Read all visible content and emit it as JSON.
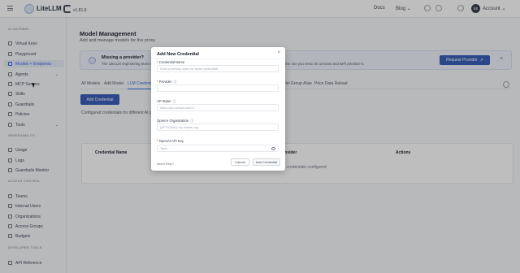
{
  "header": {
    "brand": "LiteLLM",
    "version": "v1.81.9",
    "docs": "Docs",
    "blog": "Blog",
    "avatar": "SE",
    "account": "Account",
    "icons": [
      "theme-icon",
      "github-icon",
      "bell-icon"
    ]
  },
  "sidebar": {
    "sections": [
      {
        "title": "AI GATEWAY",
        "items": [
          {
            "label": "Virtual Keys",
            "icon": "key-icon"
          },
          {
            "label": "Playground",
            "icon": "play-icon"
          },
          {
            "label": "Models + Endpoints",
            "icon": "models-icon",
            "active": true
          },
          {
            "label": "Agents",
            "icon": "agents-icon",
            "chevron": true
          },
          {
            "label": "MCP Servers",
            "icon": "mcp-icon"
          },
          {
            "label": "Skills",
            "icon": "skills-icon"
          },
          {
            "label": "Guardrails",
            "icon": "shield-icon"
          },
          {
            "label": "Policies",
            "icon": "policy-icon"
          },
          {
            "label": "Tools",
            "icon": "tools-icon",
            "chevron": true
          }
        ]
      },
      {
        "title": "OBSERVABILITY",
        "items": [
          {
            "label": "Usage",
            "icon": "usage-icon"
          },
          {
            "label": "Logs",
            "icon": "logs-icon"
          },
          {
            "label": "Guardrails Monitor",
            "icon": "monitor-icon"
          }
        ]
      },
      {
        "title": "ACCESS CONTROL",
        "items": [
          {
            "label": "Teams",
            "icon": "teams-icon"
          },
          {
            "label": "Internal Users",
            "icon": "user-icon"
          },
          {
            "label": "Organizations",
            "icon": "org-icon"
          },
          {
            "label": "Access Groups",
            "icon": "group-icon"
          },
          {
            "label": "Budgets",
            "icon": "budget-icon"
          }
        ]
      },
      {
        "title": "DEVELOPER TOOLS",
        "items": [
          {
            "label": "API Reference",
            "icon": "api-icon"
          }
        ]
      }
    ]
  },
  "page": {
    "title": "Model Management",
    "subtitle": "Add and manage models for the proxy"
  },
  "banner": {
    "title": "Missing a provider?",
    "text": "The LiteLLM engineering team is constantly adding support for new LLM models, providers, endpoints. If you don't see the one you need, let us know and we'll prioritize it.",
    "button": "Request Provider",
    "close": "×"
  },
  "tabs": [
    {
      "label": "All Models"
    },
    {
      "label": "Add Model"
    },
    {
      "label": "LLM Credentials",
      "active": true
    },
    {
      "label": "Pass-Through Endpoints"
    },
    {
      "label": "Health Status"
    },
    {
      "label": "Model Retry Settings"
    },
    {
      "label": "Model Group Alias"
    },
    {
      "label": "Price Data Reload"
    }
  ],
  "credentials": {
    "add_button": "Add Credential",
    "description": "Configured credentials for different AI providers. Add and manage your API credentials.",
    "columns": [
      "Credential Name",
      "Provider",
      "Actions"
    ],
    "empty": "No credentials configured"
  },
  "modal": {
    "title": "Add New Credential",
    "close": "×",
    "fields": [
      {
        "label": "Credential Name",
        "required": true,
        "placeholder": "Enter a friendly name for these credentials"
      },
      {
        "label": "Provider",
        "required": true,
        "info": "ⓘ",
        "placeholder": ""
      },
      {
        "label": "API Base",
        "required": false,
        "info": "ⓘ",
        "placeholder": "https://api.openai.com/v1"
      },
      {
        "label": "OpenAI Organization",
        "required": false,
        "info": "ⓘ",
        "placeholder": "[OPTIONAL] my-unique-org"
      },
      {
        "label": "OpenAI API Key",
        "required": true,
        "placeholder": "Type..."
      }
    ],
    "need_help": "Need Help?",
    "cancel": "Cancel",
    "submit": "Add Credential"
  }
}
